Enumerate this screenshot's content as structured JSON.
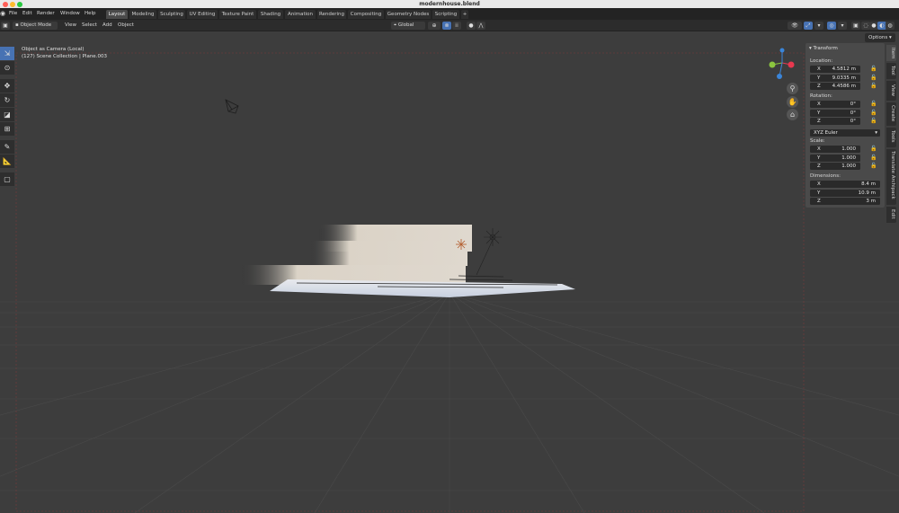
{
  "window": {
    "title": "modernhouse.blend"
  },
  "topbar": {
    "menus": [
      "File",
      "Edit",
      "Render",
      "Window",
      "Help"
    ],
    "tabs": [
      "Layout",
      "Modeling",
      "Sculpting",
      "UV Editing",
      "Texture Paint",
      "Shading",
      "Animation",
      "Rendering",
      "Compositing",
      "Geometry Nodes",
      "Scripting"
    ],
    "add_tab": "+"
  },
  "header": {
    "mode": "Object Mode",
    "menus": [
      "View",
      "Select",
      "Add",
      "Object"
    ],
    "transform_orientation": "Global",
    "options": "Options"
  },
  "viewport": {
    "view_name": "Object as Camera (Local)",
    "collection_info": "(127) Scene Collection | Plane.003",
    "gizmo_axes": {
      "x": "#e8384f",
      "y": "#8cc63f",
      "z": "#3a85d9"
    }
  },
  "npanel": {
    "title": "Transform",
    "location_label": "Location:",
    "location": [
      {
        "axis": "X",
        "value": "4.5812 m"
      },
      {
        "axis": "Y",
        "value": "9.0335 m"
      },
      {
        "axis": "Z",
        "value": "4.4586 m"
      }
    ],
    "rotation_label": "Rotation:",
    "rotation": [
      {
        "axis": "X",
        "value": "0°"
      },
      {
        "axis": "Y",
        "value": "0°"
      },
      {
        "axis": "Z",
        "value": "0°"
      }
    ],
    "rotation_mode": "XYZ Euler",
    "scale_label": "Scale:",
    "scale": [
      {
        "axis": "X",
        "value": "1.000"
      },
      {
        "axis": "Y",
        "value": "1.000"
      },
      {
        "axis": "Z",
        "value": "1.000"
      }
    ],
    "dimensions_label": "Dimensions:",
    "dimensions": [
      {
        "axis": "X",
        "value": "8.4 m"
      },
      {
        "axis": "Y",
        "value": "10.9 m"
      },
      {
        "axis": "Z",
        "value": "3 m"
      }
    ]
  },
  "side_tabs": [
    "Item",
    "Tool",
    "View",
    "Create",
    "Tools",
    "Translate Archipack",
    "Edit"
  ],
  "colors": {
    "accent": "#4772b3",
    "background": "#3d3d3d"
  }
}
